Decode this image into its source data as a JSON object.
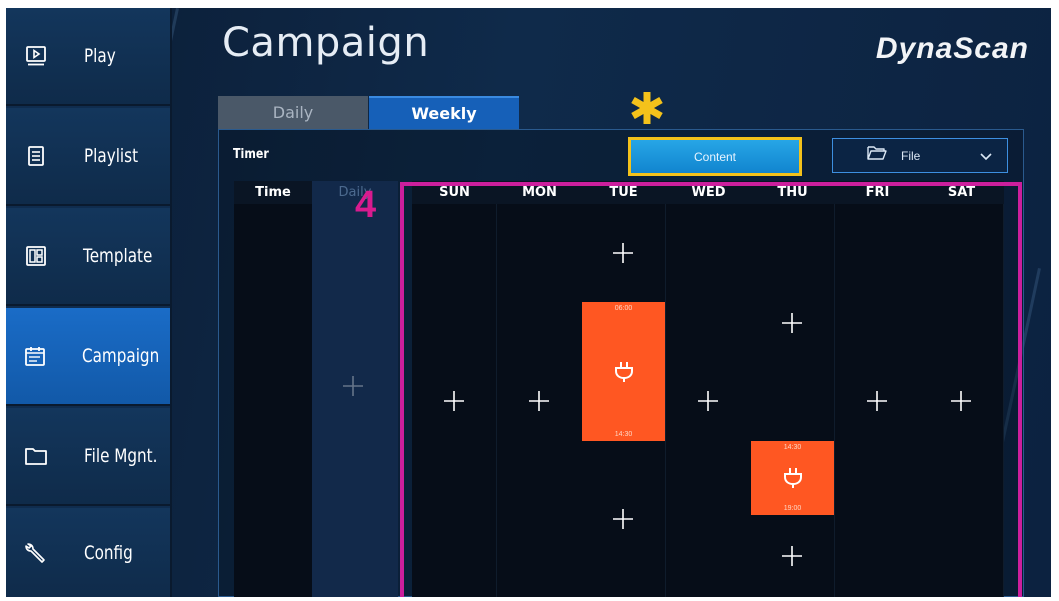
{
  "brand": "DynaScan",
  "page_title": "Campaign",
  "sidebar": {
    "items": [
      {
        "label": "Play",
        "icon": "play-icon",
        "active": false
      },
      {
        "label": "Playlist",
        "icon": "playlist-icon",
        "active": false
      },
      {
        "label": "Template",
        "icon": "template-icon",
        "active": false
      },
      {
        "label": "Campaign",
        "icon": "calendar-icon",
        "active": true
      },
      {
        "label": "File Mgnt.",
        "icon": "folder-icon",
        "active": false
      },
      {
        "label": "Config",
        "icon": "wrench-icon",
        "active": false
      }
    ]
  },
  "tabs": [
    {
      "label": "Daily",
      "active": false
    },
    {
      "label": "Weekly",
      "active": true
    }
  ],
  "toolbar": {
    "timer_label": "Timer",
    "content_button": "Content",
    "file_dropdown": "File"
  },
  "grid": {
    "time_header": "Time",
    "daily_header": "Daily",
    "days": [
      "SUN",
      "MON",
      "TUE",
      "WED",
      "THU",
      "FRI",
      "SAT"
    ],
    "events": [
      {
        "day": "TUE",
        "start": "06:00",
        "end": "14:30",
        "icon": "plug-icon"
      },
      {
        "day": "THU",
        "start": "14:30",
        "end": "19:00",
        "icon": "plug-icon"
      }
    ]
  },
  "annotations": {
    "step_number": "4",
    "highlight_marker": "*"
  },
  "colors": {
    "accent": "#1660b8",
    "event": "#ff5722",
    "highlight_box": "#cc1f9d",
    "marker": "#f4c21b"
  }
}
